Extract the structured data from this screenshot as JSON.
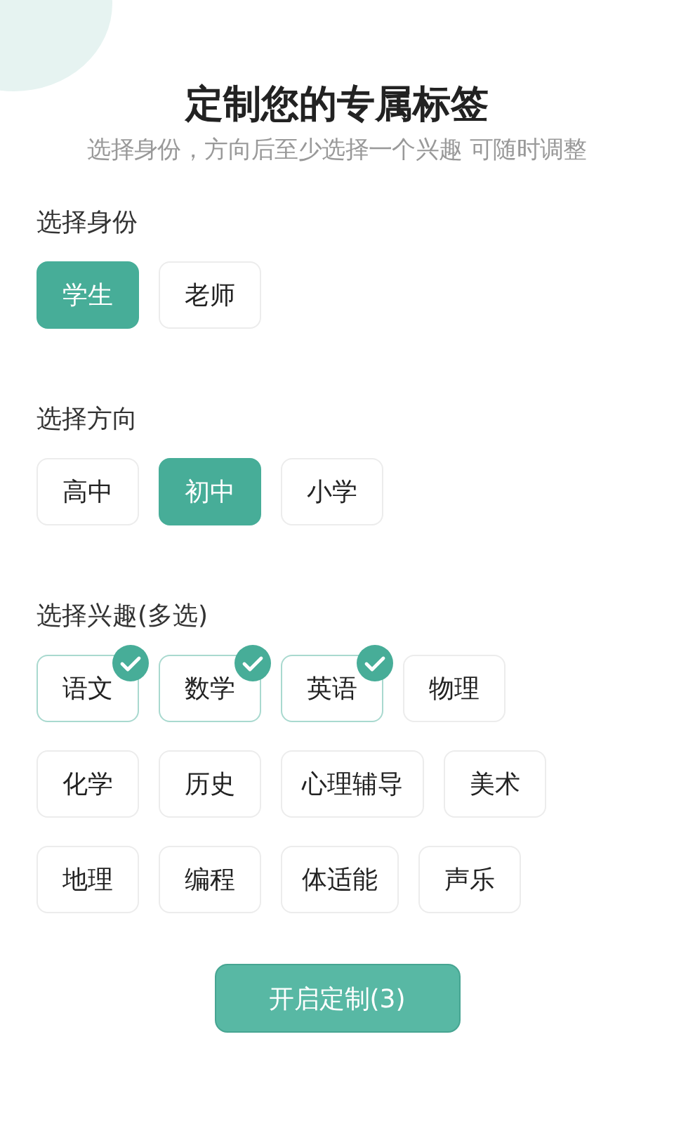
{
  "title": "定制您的专属标签",
  "subtitle": "选择身份，方向后至少选择一个兴趣 可随时调整",
  "sections": [
    {
      "label": "选择身份",
      "options": [
        {
          "label": "学生",
          "selected": true
        },
        {
          "label": "老师",
          "selected": false
        }
      ]
    },
    {
      "label": "选择方向",
      "options": [
        {
          "label": "高中",
          "selected": false
        },
        {
          "label": "初中",
          "selected": true
        },
        {
          "label": "小学",
          "selected": false
        }
      ]
    },
    {
      "label": "选择兴趣(多选)",
      "options": [
        {
          "label": "语文",
          "checked": true
        },
        {
          "label": "数学",
          "checked": true
        },
        {
          "label": "英语",
          "checked": true
        },
        {
          "label": "物理",
          "checked": false
        },
        {
          "label": "化学",
          "checked": false
        },
        {
          "label": "历史",
          "checked": false
        },
        {
          "label": "心理辅导",
          "checked": false
        },
        {
          "label": "美术",
          "checked": false
        },
        {
          "label": "地理",
          "checked": false
        },
        {
          "label": "编程",
          "checked": false
        },
        {
          "label": "体适能",
          "checked": false
        },
        {
          "label": "声乐",
          "checked": false
        }
      ]
    }
  ],
  "submit_button": "开启定制(3)"
}
